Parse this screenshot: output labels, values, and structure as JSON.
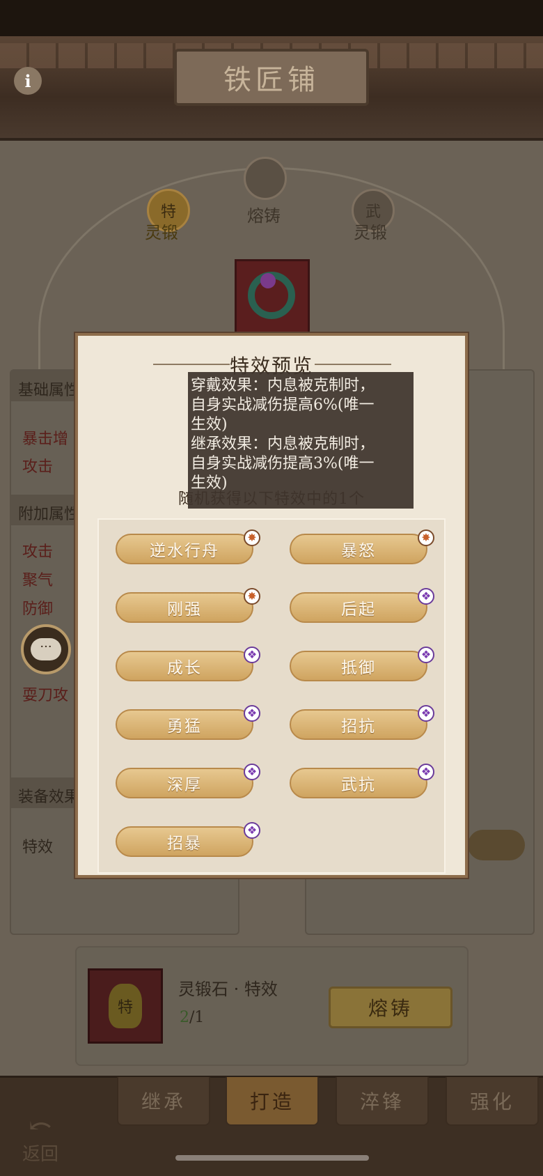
{
  "header": {
    "title": "铁匠铺",
    "info_icon": "i"
  },
  "tiers": [
    {
      "label": "灵锻",
      "glyph": "特"
    },
    {
      "label": "熔铸",
      "glyph": ""
    },
    {
      "label": "灵锻",
      "glyph": "武"
    }
  ],
  "left_panel": {
    "base_header": "基础属性",
    "base_stats": [
      "暴击增",
      "攻击"
    ],
    "extra_header": "附加属性",
    "extra_stats": [
      "攻击",
      "聚气",
      "防御",
      "耍刀攻"
    ],
    "equip_header": "装备效果",
    "fx_label": "特效"
  },
  "chat": {
    "icon": "chat-bubble-icon",
    "text": "···"
  },
  "material": {
    "name": "灵锻石 · 特效",
    "have": "2",
    "need": "/1",
    "stone_glyph": "特"
  },
  "fuse_button": "熔铸",
  "nav_tabs": [
    "继承",
    "打造",
    "淬锋",
    "强化"
  ],
  "back_label": "返回",
  "modal": {
    "title": "特效预览",
    "tooltip_lines": [
      "穿戴效果：内息被克制时，",
      "自身实战减伤提高6%(唯一",
      "生效)",
      "继承效果：内息被克制时，",
      "自身实战减伤提高3%(唯一",
      "生效)"
    ],
    "random_note": "随机获得以下特效中的1个",
    "effects": [
      {
        "label": "逆水行舟",
        "badge": "orange"
      },
      {
        "label": "暴怒",
        "badge": "orange"
      },
      {
        "label": "刚强",
        "badge": "orange"
      },
      {
        "label": "后起",
        "badge": "purple"
      },
      {
        "label": "成长",
        "badge": "purple"
      },
      {
        "label": "抵御",
        "badge": "purple"
      },
      {
        "label": "勇猛",
        "badge": "purple"
      },
      {
        "label": "招抗",
        "badge": "purple"
      },
      {
        "label": "深厚",
        "badge": "purple"
      },
      {
        "label": "武抗",
        "badge": "purple"
      },
      {
        "label": "招暴",
        "badge": "purple"
      }
    ]
  },
  "colors": {
    "accent_gold": "#cfa460",
    "badge_orange": "#c8602a",
    "badge_purple": "#7a3ab0"
  }
}
